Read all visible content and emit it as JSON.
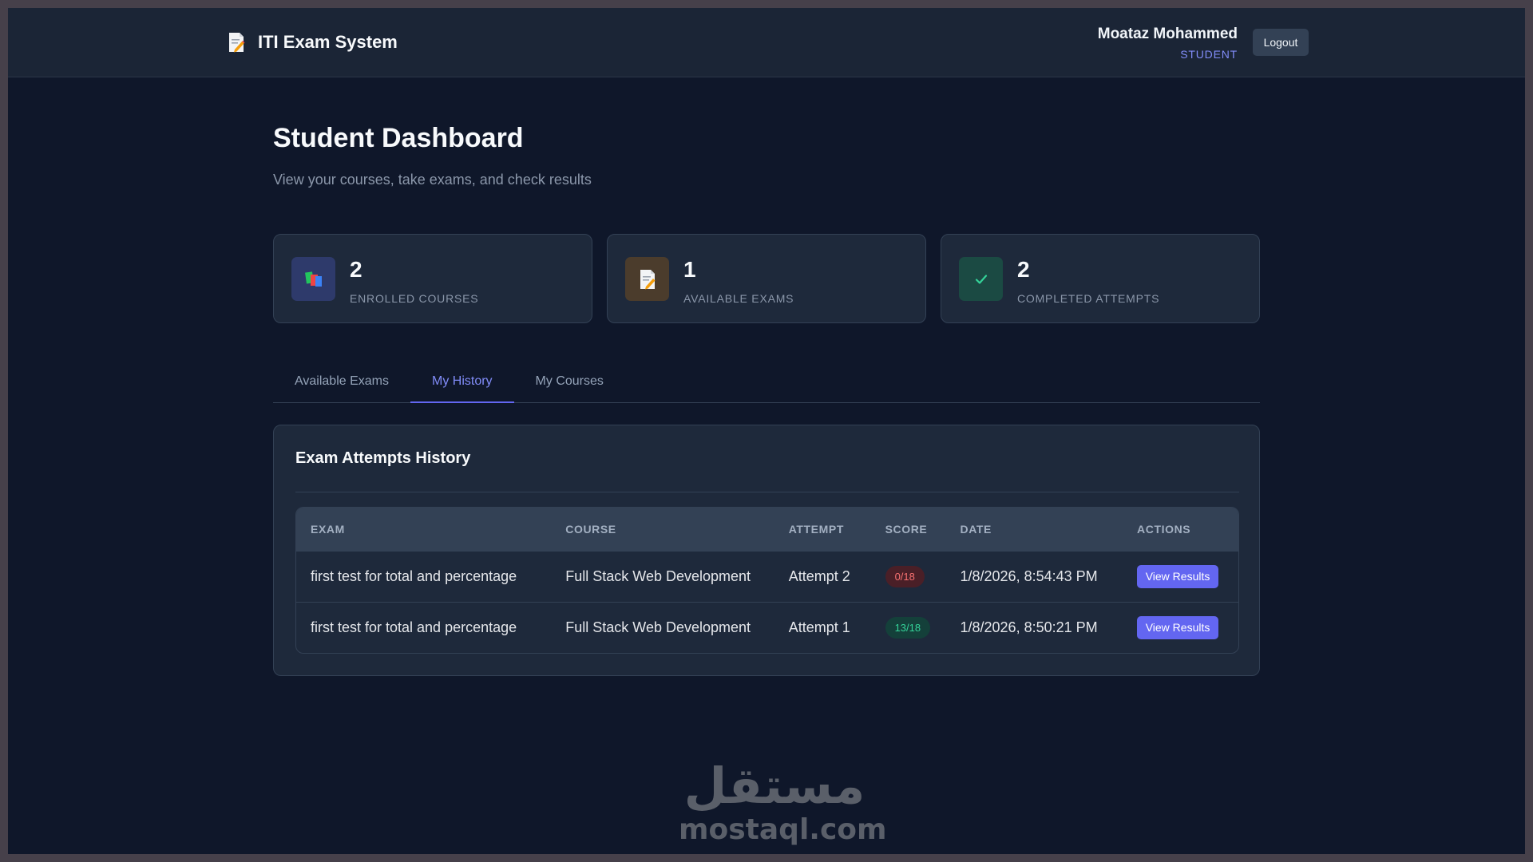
{
  "header": {
    "brand_title": "ITI Exam System",
    "brand_icon": "memo-icon",
    "user_name": "Moataz Mohammed",
    "user_role": "STUDENT",
    "logout_label": "Logout"
  },
  "page": {
    "title": "Student Dashboard",
    "subtitle": "View your courses, take exams, and check results"
  },
  "stats": [
    {
      "value": "2",
      "label": "ENROLLED COURSES",
      "icon": "books-icon",
      "icon_bg": "#2e3a6b"
    },
    {
      "value": "1",
      "label": "AVAILABLE EXAMS",
      "icon": "memo-icon",
      "icon_bg": "#4b3c2c"
    },
    {
      "value": "2",
      "label": "COMPLETED ATTEMPTS",
      "icon": "check-icon",
      "icon_bg": "#1b4a43"
    }
  ],
  "tabs": [
    {
      "label": "Available Exams",
      "active": false
    },
    {
      "label": "My History",
      "active": true
    },
    {
      "label": "My Courses",
      "active": false
    }
  ],
  "history": {
    "title": "Exam Attempts History",
    "columns": [
      "EXAM",
      "COURSE",
      "ATTEMPT",
      "SCORE",
      "DATE",
      "ACTIONS"
    ],
    "rows": [
      {
        "exam": "first test for total and percentage",
        "course": "Full Stack Web Development",
        "attempt": "Attempt 2",
        "score": "0/18",
        "date": "1/8/2026, 8:54:43 PM",
        "action": "View Results"
      },
      {
        "exam": "first test for total and percentage",
        "course": "Full Stack Web Development",
        "attempt": "Attempt 1",
        "score": "13/18",
        "date": "1/8/2026, 8:50:21 PM",
        "action": "View Results"
      }
    ]
  },
  "watermark": {
    "arabic": "مستقل",
    "latin": "mostaql.com"
  },
  "colors": {
    "accent": "#6366f1",
    "accent_text": "#818cf8",
    "bg": "#0f172a",
    "card": "#1e293b",
    "score_bad": "#f87171",
    "score_good": "#34d399"
  }
}
